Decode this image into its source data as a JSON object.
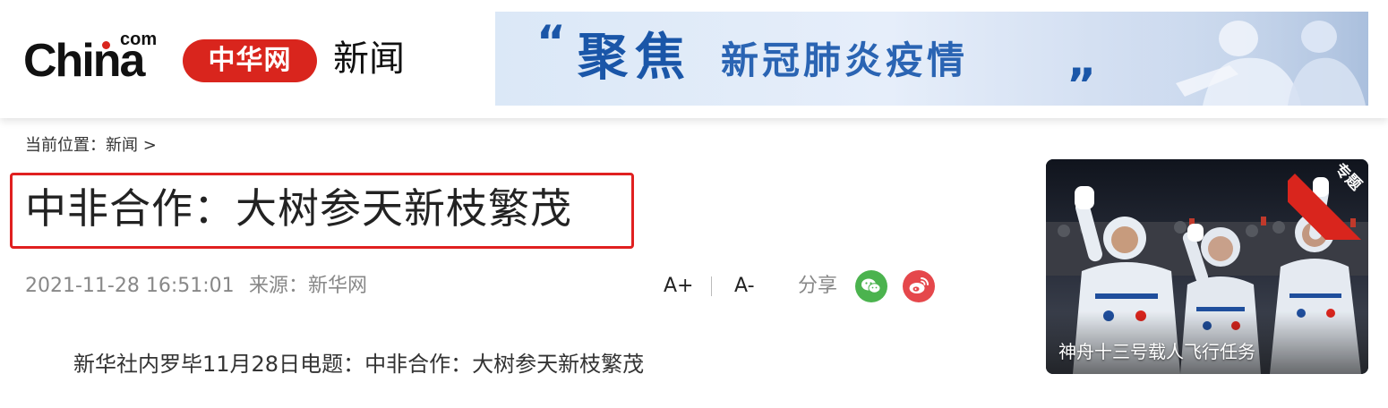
{
  "header": {
    "logo": {
      "wordmark": "China",
      "suffix": "com",
      "pill_text": "中华网"
    },
    "section_title": "新闻",
    "banner": {
      "quote_open": "“",
      "big_text": "聚焦",
      "small_text": "新冠肺炎疫情",
      "quote_close": "”"
    }
  },
  "breadcrumb": {
    "label": "当前位置：",
    "items": [
      {
        "label": "新闻"
      }
    ],
    "separator": ">"
  },
  "article": {
    "title": "中非合作：大树参天新枝繁茂",
    "date": "2021-11-28 16:51:01",
    "source": "来源：新华网",
    "lead": "新华社内罗毕11月28日电题：中非合作：大树参天新枝繁茂"
  },
  "toolbar": {
    "font_increase": "A+",
    "font_decrease": "A-",
    "share_label": "分享",
    "share_icons": [
      "wechat-icon",
      "weibo-icon"
    ]
  },
  "side_card": {
    "badge": "专题",
    "caption": "神舟十三号载人飞行任务"
  },
  "colors": {
    "brand_red": "#d9251d",
    "highlight_red": "#e02020",
    "banner_blue": "#1a56a8",
    "wechat_green": "#4bb34e",
    "weibo_red": "#e5474b"
  }
}
